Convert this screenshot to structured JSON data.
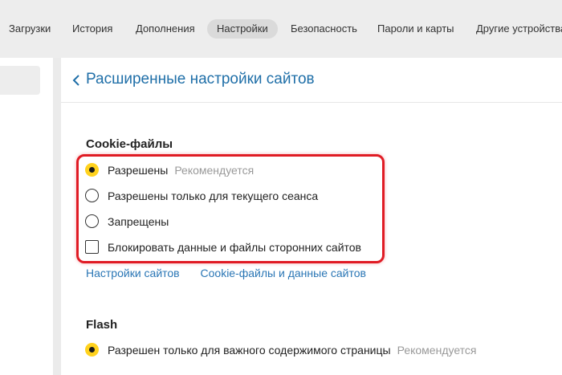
{
  "topnav": {
    "tabs": [
      {
        "label": "Загрузки"
      },
      {
        "label": "История"
      },
      {
        "label": "Дополнения"
      },
      {
        "label": "Настройки"
      },
      {
        "label": "Безопасность"
      },
      {
        "label": "Пароли и карты"
      },
      {
        "label": "Другие устройства"
      }
    ],
    "active_tab": "Настройки"
  },
  "header": {
    "back_icon": "chevron-left-icon",
    "title": "Расширенные настройки сайтов"
  },
  "cookies": {
    "title": "Cookie-файлы",
    "options": [
      {
        "label": "Разрешены",
        "hint": "Рекомендуется",
        "selected": true
      },
      {
        "label": "Разрешены только для текущего сеанса",
        "selected": false
      },
      {
        "label": "Запрещены",
        "selected": false
      }
    ],
    "block_third_party": {
      "label": "Блокировать данные и файлы сторонних сайтов",
      "checked": false
    },
    "links": [
      {
        "label": "Настройки сайтов"
      },
      {
        "label": "Cookie-файлы и данные сайтов"
      }
    ]
  },
  "flash": {
    "title": "Flash",
    "options": [
      {
        "label": "Разрешен только для важного содержимого страницы",
        "hint": "Рекомендуется",
        "selected": true
      }
    ]
  },
  "colors": {
    "accent_radio": "#ffd21e",
    "link": "#2a76b5",
    "highlight_border": "#e01b24"
  }
}
